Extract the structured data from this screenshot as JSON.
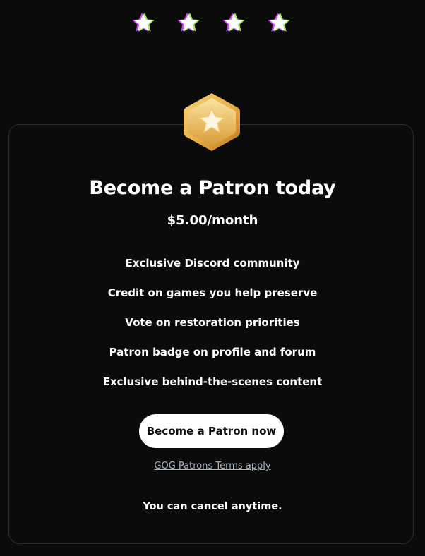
{
  "decorations": {
    "star_count": 4,
    "star_colors": {
      "fill": "#ffffff",
      "offset_left": "#e040fb",
      "offset_right": "#a5e65a"
    }
  },
  "badge": {
    "icon": "star-badge-icon",
    "colors": [
      "#f7d27a",
      "#e8ad45",
      "#b8761d"
    ]
  },
  "card": {
    "title": "Become a Patron today",
    "price": "$5.00/month",
    "benefits": [
      "Exclusive Discord community",
      "Credit on games you help preserve",
      "Vote on restoration priorities",
      "Patron badge on profile and forum",
      "Exclusive behind-the-scenes content"
    ],
    "cta_label": "Become a Patron now",
    "terms_link": "GOG Patrons Terms apply",
    "cancel_note": "You can cancel anytime."
  },
  "colors": {
    "background": "#0b0b0b",
    "card_border": "#2e2e2e",
    "button_bg": "#ffffff",
    "button_text": "#111111",
    "link": "#a7b4c4"
  }
}
